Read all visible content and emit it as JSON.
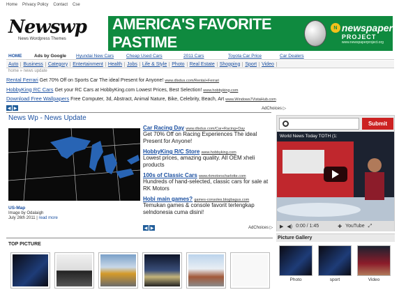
{
  "top_links": [
    "Home",
    "Privacy Policy",
    "Contact",
    "Cse"
  ],
  "logo": {
    "title": "Newswp",
    "subtitle": "News Wordpress Themes"
  },
  "banner": {
    "headline": "AMERICA'S FAVORITE PASTIME",
    "brand_badge": "N",
    "brand_word": "newspaper",
    "brand_project": "PROJECT",
    "brand_url": "www.newspaperproject.org",
    "color": "#0f8a3f"
  },
  "nav1": {
    "home": "HOME",
    "ads_by": "Ads by Google",
    "links": [
      "Hyundai New Cars",
      "Cheap Used Cars",
      "2011 Cars",
      "Toyota Car Price",
      "Car Dealers"
    ]
  },
  "nav2": [
    "Auto",
    "Business",
    "Category",
    "Entertainment",
    "Health",
    "Jobs",
    "Life & Style",
    "Photo",
    "Real Estate",
    "Shopping",
    "Sport",
    "Video"
  ],
  "breadcrumb": "home » news update",
  "text_ads": [
    {
      "title": "Rental Ferrari",
      "desc": " Get 70% Off on Sports Car The ideal Present for Anyone! ",
      "url": "www.dlsdus.com/Rental+Ferrari"
    },
    {
      "title": "HobbyKing RC Cars",
      "desc": " Get your RC Cars at HobbyKing.com Lowest Prices, Best Selection! ",
      "url": "www.hobbyking.com"
    },
    {
      "title": "Download Free Wallpapers",
      "desc": " Free Computer, 3d, Abstract, Animal Nature, Bike, Celebrity, Beach, Art ",
      "url": "www.Windows7VistaHub.com"
    }
  ],
  "adchoices": "AdChoices ▷",
  "news_section_title": "News Wp - News Update",
  "featured": {
    "title": "US-Map",
    "credit": "Image by Odalaigh",
    "date": "July 26th 2011",
    "read_more": "read more",
    "separator": " | "
  },
  "side_ads": [
    {
      "title": "Car Racing Day",
      "url": "www.dlsdus.com/Car+Racing+Day",
      "desc": "Get 70% Off on Racing Experiences The ideal Present for Anyone!"
    },
    {
      "title": "HobbyKing R/C Store",
      "url": "www.hobbyking.com",
      "desc": "Lowest prices, amazing quality. All OEM xheli products"
    },
    {
      "title": "100s of Classic Cars",
      "url": "www.rkmotorscharlotte.com",
      "desc": "Hundreds of hand-selected, classic cars for sale at RK Motors"
    },
    {
      "title": "Hobi main games?",
      "url": "games-consoles.blogbagus.com",
      "desc": "Temukan games & console favorit terlengkap selndonesia cuma disini!"
    }
  ],
  "video": {
    "submit": "Submit",
    "title": "World News Today TOTH (1:",
    "time": "0:00 / 1:45",
    "brand": "YouTube"
  },
  "top_picture_title": "TOP PICTURE",
  "gallery": {
    "title": "Picture Gallery",
    "labels": [
      "Photo",
      "sport",
      "Video"
    ]
  }
}
